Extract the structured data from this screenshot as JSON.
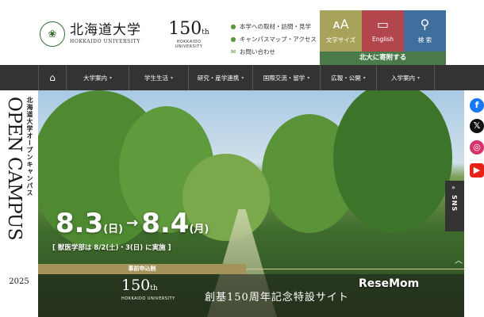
{
  "header": {
    "logo_jp": "北海道大学",
    "logo_en": "HOKKAIDO UNIVERSITY",
    "anniv_number": "150",
    "anniv_suffix": "th",
    "anniv_en": "HOKKAIDO UNIVERSITY",
    "utility": [
      {
        "icon": "info-icon",
        "glyph": "●",
        "label": "本学への取材・訪問・見学"
      },
      {
        "icon": "map-pin-icon",
        "glyph": "●",
        "label": "キャンパスマップ・アクセス"
      },
      {
        "icon": "mail-icon",
        "glyph": "✉",
        "label": "お問い合わせ"
      }
    ],
    "tools": [
      {
        "label": "文字サイズ",
        "glyph": "ᴀA",
        "color": "#a8a35a"
      },
      {
        "label": "English",
        "glyph": "▭",
        "color": "#b3454d"
      },
      {
        "label": "検 索",
        "glyph": "⚲",
        "color": "#3f6f9c"
      }
    ],
    "donate": "北大に寄附する"
  },
  "nav": {
    "items": [
      "大学案内",
      "学生生活",
      "研究・産学連携",
      "国際交流・留学",
      "広報・公開",
      "入学案内"
    ]
  },
  "hero": {
    "side_jp": "北海道大学オープンキャンパス",
    "side_en": "OPEN CAMPUS",
    "side_year": "2025",
    "date1": "8.3",
    "date1_day": "(日)",
    "arrow": "→",
    "date2": "8.4",
    "date2_day": "(月)",
    "note": "[ 獣医学部は 8/2(土)・3(日) に実施 ]",
    "registration": "事前申込制",
    "banner_number": "150",
    "banner_suffix": "th",
    "banner_en": "HOKKAIDO UNIVERSITY",
    "banner_site": "創基150周年記念特設サイト",
    "watermark": "ReseMom"
  },
  "sns": {
    "tab_label": "SNS",
    "icons": [
      {
        "name": "facebook-icon",
        "glyph": "f",
        "color": "#1877f2"
      },
      {
        "name": "x-icon",
        "glyph": "𝕏",
        "color": "#111111"
      },
      {
        "name": "instagram-icon",
        "glyph": "◎",
        "color": "#d6336c"
      },
      {
        "name": "youtube-icon",
        "glyph": "▶",
        "color": "#e62117"
      }
    ]
  }
}
